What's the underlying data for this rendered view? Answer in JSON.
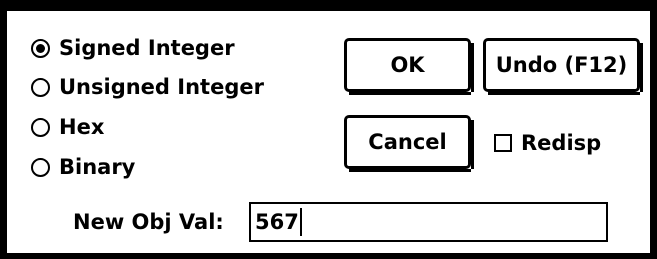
{
  "radio_group": {
    "options": [
      {
        "label": "Signed Integer",
        "checked": true
      },
      {
        "label": "Unsigned Integer",
        "checked": false
      },
      {
        "label": "Hex",
        "checked": false
      },
      {
        "label": "Binary",
        "checked": false
      }
    ]
  },
  "buttons": {
    "ok_label": "OK",
    "undo_label": "Undo (F12)",
    "cancel_label": "Cancel"
  },
  "redisp": {
    "label": "Redisp",
    "checked": false
  },
  "new_value": {
    "label": "New Obj Val:",
    "value": "567"
  }
}
